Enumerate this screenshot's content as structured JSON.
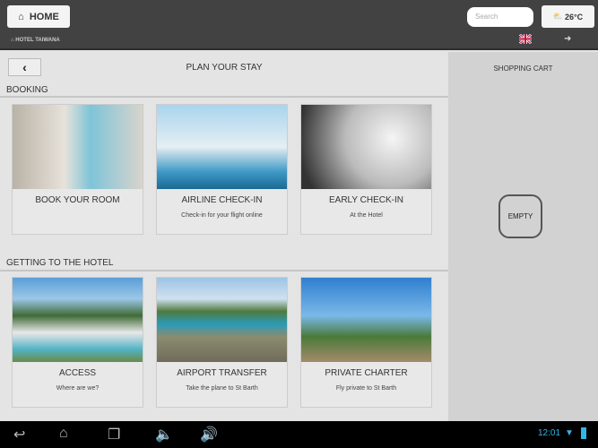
{
  "header": {
    "home_label": "HOME",
    "search_placeholder": "Search",
    "temperature": "26°C",
    "hotel_name": "HOTEL TAIWANA"
  },
  "page": {
    "title": "PLAN YOUR STAY"
  },
  "sections": [
    {
      "title": "BOOKING",
      "cards": [
        {
          "title": "BOOK YOUR ROOM",
          "subtitle": ""
        },
        {
          "title": "AIRLINE CHECK-IN",
          "subtitle": "Check-in for your flight online"
        },
        {
          "title": "EARLY CHECK-IN",
          "subtitle": "At the Hotel"
        }
      ]
    },
    {
      "title": "GETTING TO THE HOTEL",
      "cards": [
        {
          "title": "ACCESS",
          "subtitle": "Where are we?"
        },
        {
          "title": "AIRPORT TRANSFER",
          "subtitle": "Take the plane to St Barth"
        },
        {
          "title": "PRIVATE CHARTER",
          "subtitle": "Fly private to St Barth"
        }
      ]
    }
  ],
  "cart": {
    "title": "SHOPPING CART",
    "empty_label": "EMPTY"
  },
  "status": {
    "time": "12:01"
  }
}
